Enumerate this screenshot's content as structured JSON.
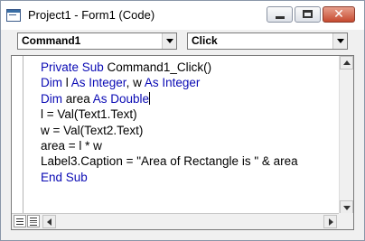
{
  "window": {
    "title": "Project1 - Form1 (Code)",
    "controls": {
      "minimize": "minimize",
      "maximize": "maximize",
      "close": "✕"
    }
  },
  "toolbar": {
    "object_combo": {
      "value": "Command1"
    },
    "procedure_combo": {
      "value": "Click"
    }
  },
  "editor": {
    "lines": [
      {
        "kw1": "Private Sub",
        "rest": " Command1_Click()"
      },
      {
        "kw1": "Dim",
        "mid1": " l ",
        "kw2": "As Integer",
        "mid2": ", w ",
        "kw3": "As Integer"
      },
      {
        "kw1": "Dim",
        "mid1": " area ",
        "kw2": "As Double"
      },
      {
        "text": "l = Val(Text1.Text)"
      },
      {
        "text": "w = Val(Text2.Text)"
      },
      {
        "text": "area = l * w"
      },
      {
        "text": "Label3.Caption = \"Area of Rectangle is \" & area"
      },
      {
        "kw1": "End Sub"
      }
    ]
  },
  "colors": {
    "keyword": "#0a0ab4",
    "text": "#000000",
    "close_button": "#c64a2f"
  },
  "icons": {
    "app": "code-window-icon",
    "procedure_view": "procedure-view-icon",
    "full_module_view": "full-module-view-icon"
  }
}
